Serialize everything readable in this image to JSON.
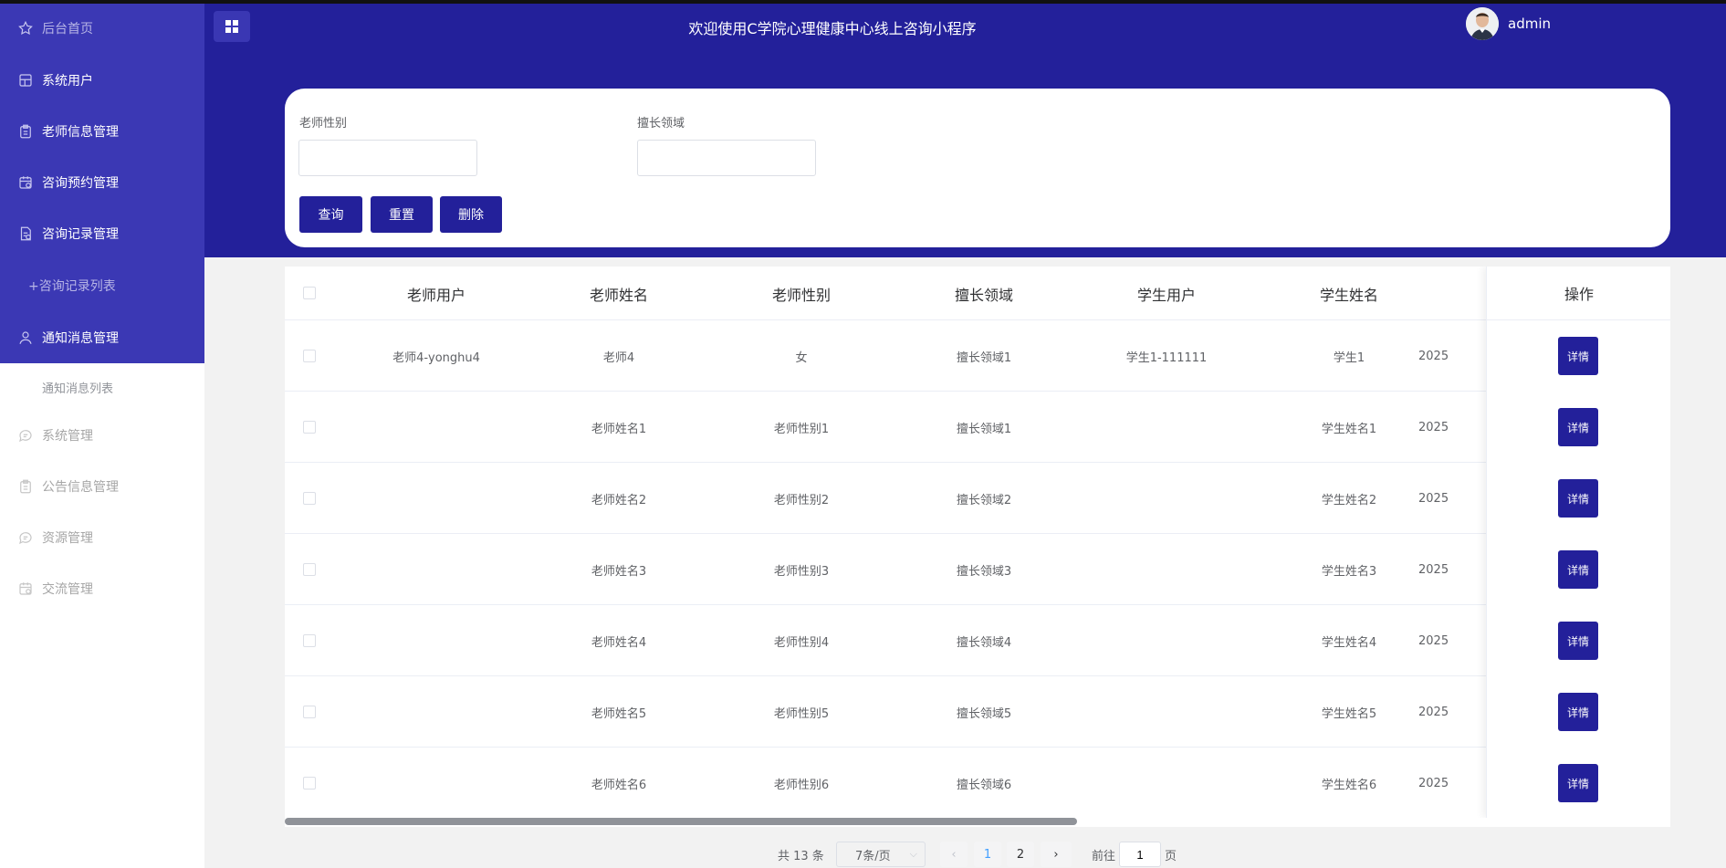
{
  "header": {
    "title": "欢迎使用C学院心理健康中心线上咨询小程序",
    "username": "admin"
  },
  "sidebar": {
    "items": [
      {
        "label": "后台首页",
        "icon": "star-icon"
      },
      {
        "label": "系统用户",
        "icon": "grid-icon"
      },
      {
        "label": "老师信息管理",
        "icon": "clipboard-icon"
      },
      {
        "label": "咨询预约管理",
        "icon": "calendar-icon"
      },
      {
        "label": "咨询记录管理",
        "icon": "document-icon"
      },
      {
        "label": "+咨询记录列表",
        "icon": ""
      },
      {
        "label": "通知消息管理",
        "icon": "user-icon"
      },
      {
        "label": "通知消息列表",
        "icon": ""
      },
      {
        "label": "系统管理",
        "icon": "chat-icon"
      },
      {
        "label": "公告信息管理",
        "icon": "clipboard-icon"
      },
      {
        "label": "资源管理",
        "icon": "chat-icon"
      },
      {
        "label": "交流管理",
        "icon": "calendar-icon"
      }
    ]
  },
  "search": {
    "gender_label": "老师性别",
    "gender_value": "",
    "field_label": "擅长领域",
    "field_value": "",
    "query_btn": "查询",
    "reset_btn": "重置",
    "delete_btn": "删除"
  },
  "table": {
    "headers": [
      "老师用户",
      "老师姓名",
      "老师性别",
      "擅长领域",
      "学生用户",
      "学生姓名"
    ],
    "action_header": "操作",
    "detail_label": "详情",
    "rows": [
      [
        "老师4-yonghu4",
        "老师4",
        "女",
        "擅长领域1",
        "学生1-111111",
        "学生1",
        "2025"
      ],
      [
        "",
        "老师姓名1",
        "老师性别1",
        "擅长领域1",
        "",
        "学生姓名1",
        "2025"
      ],
      [
        "",
        "老师姓名2",
        "老师性别2",
        "擅长领域2",
        "",
        "学生姓名2",
        "2025"
      ],
      [
        "",
        "老师姓名3",
        "老师性别3",
        "擅长领域3",
        "",
        "学生姓名3",
        "2025"
      ],
      [
        "",
        "老师姓名4",
        "老师性别4",
        "擅长领域4",
        "",
        "学生姓名4",
        "2025"
      ],
      [
        "",
        "老师姓名5",
        "老师性别5",
        "擅长领域5",
        "",
        "学生姓名5",
        "2025"
      ],
      [
        "",
        "老师姓名6",
        "老师性别6",
        "擅长领域6",
        "",
        "学生姓名6",
        "2025"
      ]
    ]
  },
  "pagination": {
    "total": "共 13 条",
    "page_size": "7条/页",
    "pages": [
      "1",
      "2"
    ],
    "current": "1",
    "goto_label": "前往",
    "goto_value": "1",
    "page_unit": "页"
  },
  "colors": {
    "primary": "#23209a",
    "sidebar_active": "#3b38b4",
    "submenu_text": "#b7b5e6"
  }
}
